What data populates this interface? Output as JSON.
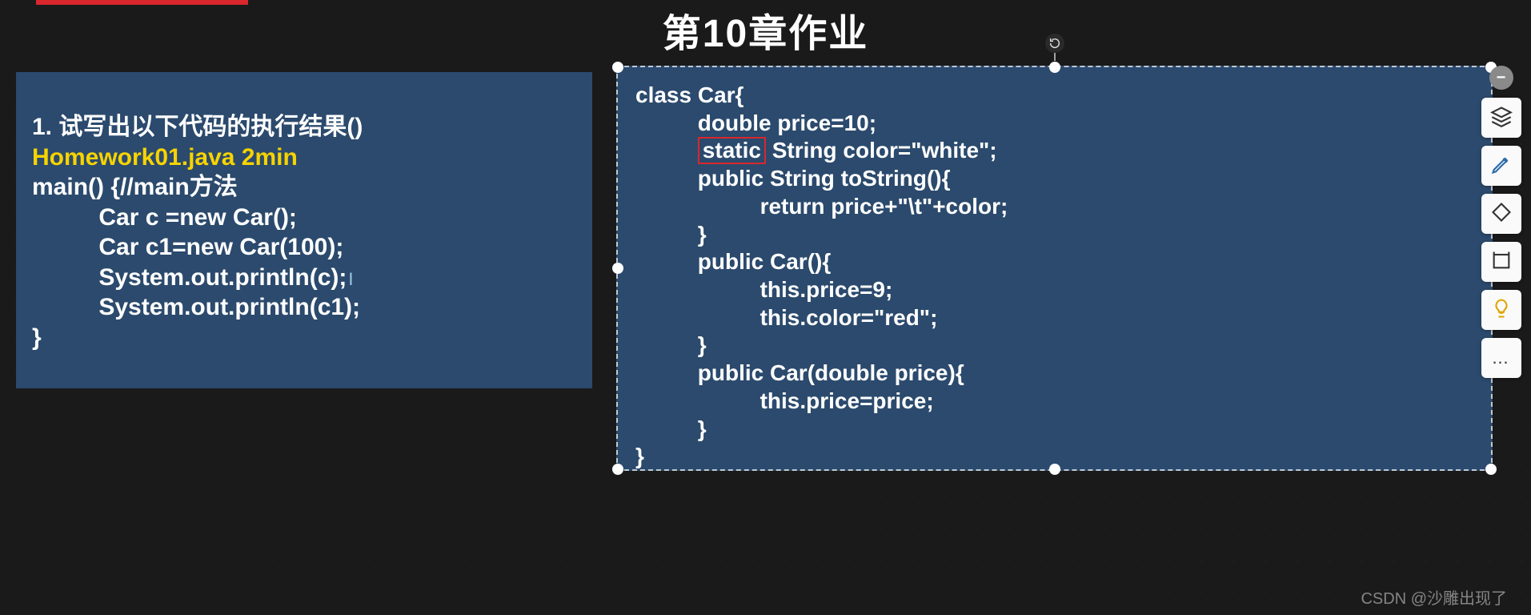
{
  "title": "第10章作业",
  "left": {
    "question": "1. 试写出以下代码的执行结果()",
    "filename": "Homework01.java 2min",
    "main_sig": "main() {//main方法",
    "line1": "          Car c =new Car();",
    "line2": "          Car c1=new Car(100);",
    "line3": "          System.out.println(c);",
    "line4": "          System.out.println(c1);",
    "close": "}"
  },
  "right": {
    "l1": "class Car{",
    "l2_indent": "          double price=10;",
    "l3_before": "          ",
    "l3_boxed": "static",
    "l3_after": " String color=\"white\";",
    "l4": "          public String toString(){",
    "l5": "                    return price+\"\\t\"+color;",
    "l6": "          }",
    "l7": "          public Car(){",
    "l8": "                    this.price=9;",
    "l9": "                    this.color=\"red\";",
    "l10": "          }",
    "l11": "          public Car(double price){",
    "l12": "                    this.price=price;",
    "l13": "          }",
    "l14": "}"
  },
  "toolbar": {
    "collapse": "−",
    "more": "…"
  },
  "watermark": "CSDN @沙雕出现了",
  "colors": {
    "panel_bg": "#2b4a6d",
    "highlight_yellow": "#f7d300",
    "annotation_red": "#d9272d"
  }
}
